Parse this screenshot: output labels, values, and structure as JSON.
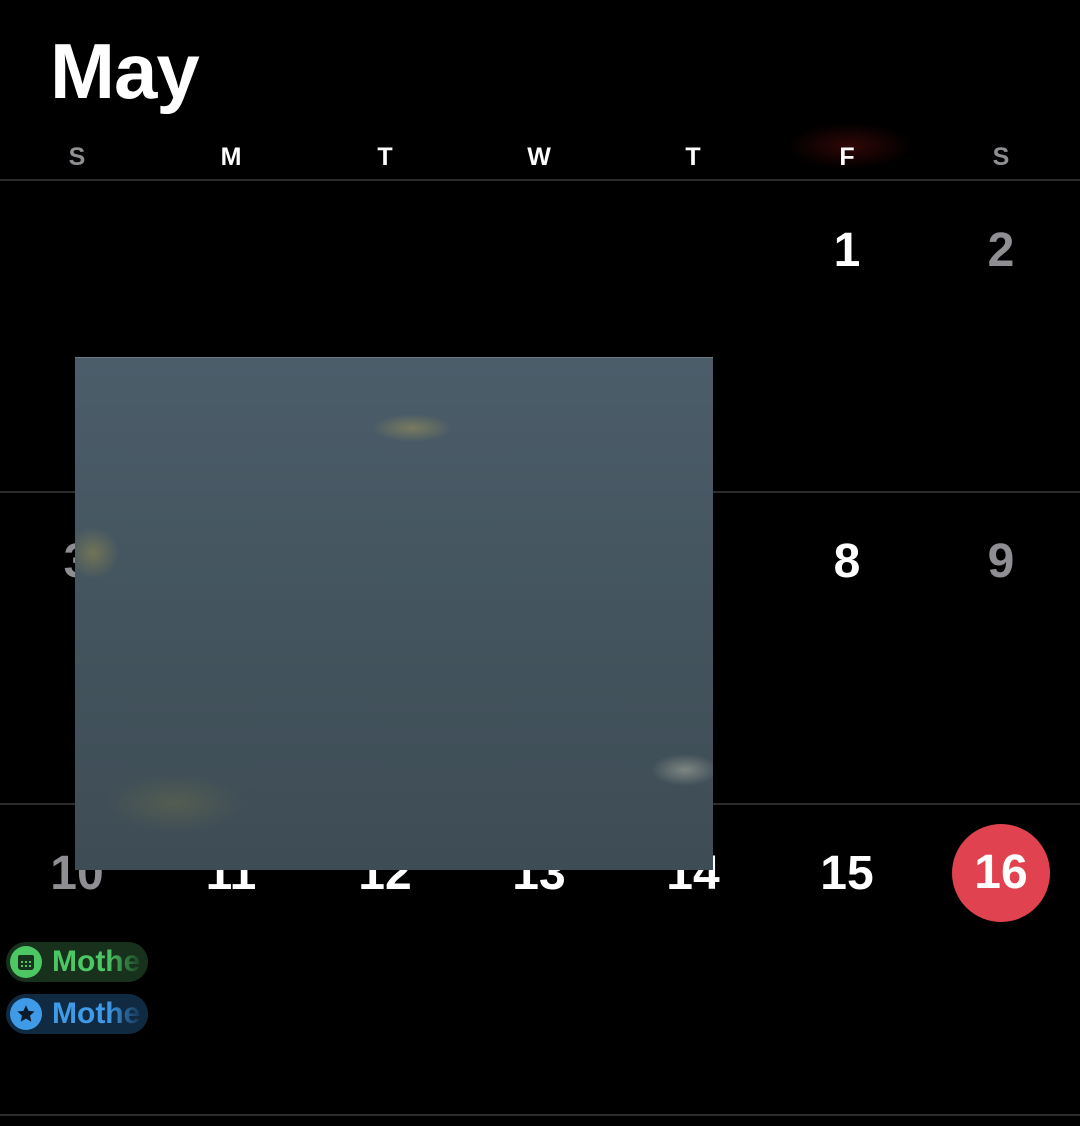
{
  "calendar": {
    "month_title": "May",
    "weekdays": [
      "S",
      "M",
      "T",
      "W",
      "T",
      "F",
      "S"
    ],
    "weeks": [
      [
        "",
        "",
        "",
        "",
        "",
        "1",
        "2"
      ],
      [
        "3",
        "",
        "",
        "",
        "",
        "8",
        "9"
      ],
      [
        "10",
        "11",
        "12",
        "13",
        "14",
        "15",
        "16"
      ]
    ],
    "today": "16",
    "events": [
      {
        "label": "Mothe",
        "icon": "calendar-icon",
        "color": "#4cc764"
      },
      {
        "label": "Mothe",
        "icon": "star-icon",
        "color": "#3f9be8"
      }
    ]
  },
  "colors": {
    "background": "#000000",
    "today_accent": "#e0434f",
    "weekend_text": "#8e8e93",
    "calendar_event": "#4cc764",
    "holiday_event": "#3f9be8"
  }
}
